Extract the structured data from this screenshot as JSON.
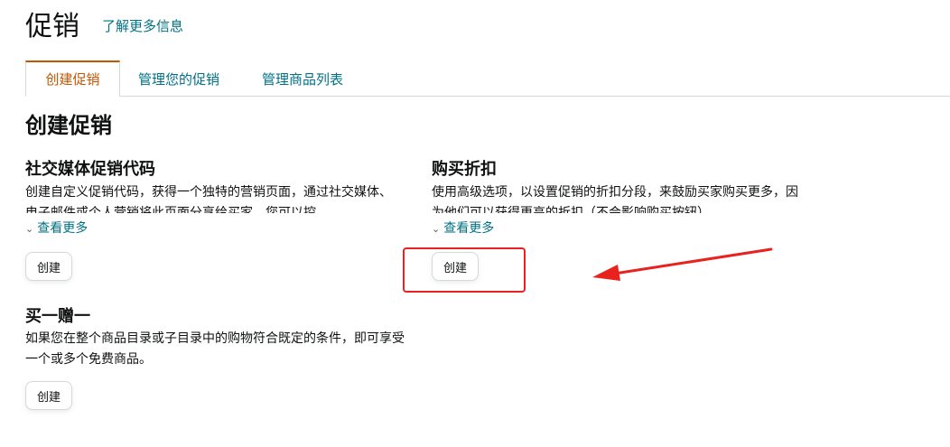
{
  "header": {
    "title": "促销",
    "learn_more": "了解更多信息"
  },
  "tabs": [
    {
      "label": "创建促销",
      "active": true
    },
    {
      "label": "管理您的促销",
      "active": false
    },
    {
      "label": "管理商品列表",
      "active": false
    }
  ],
  "main": {
    "title": "创建促销",
    "cards": [
      {
        "title": "社交媒体促销代码",
        "description": "创建自定义促销代码，获得一个独特的营销页面，通过社交媒体、电子邮件或个人营销将此页面分享给买家。您可以控",
        "see_more": "查看更多",
        "button": "创建"
      },
      {
        "title": "购买折扣",
        "description": "使用高级选项，以设置促销的折扣分段，来鼓励买家购买更多，因为他们可以获得更高的折扣（不会影响购买按钮）。",
        "see_more": "查看更多",
        "button": "创建"
      },
      {
        "title": "买一赠一",
        "description": "如果您在整个商品目录或子目录中的购物符合既定的条件，即可享受一个或多个免费商品。",
        "button": "创建"
      }
    ]
  },
  "colors": {
    "accent_link": "#007185",
    "active_tab": "#c45500",
    "annotation_red": "#e8231e"
  }
}
